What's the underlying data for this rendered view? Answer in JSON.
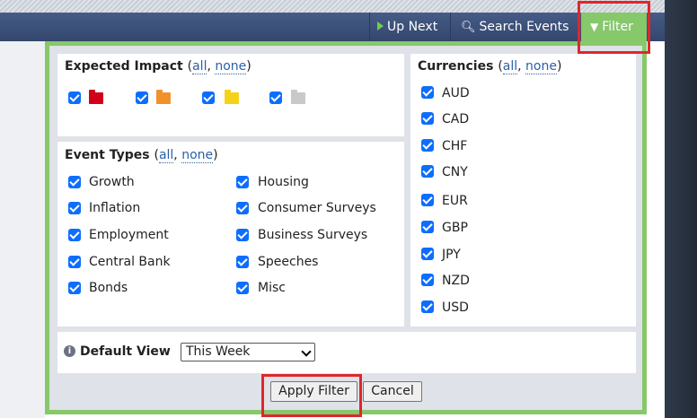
{
  "nav": {
    "up_next": "Up Next",
    "search_events": "Search Events",
    "filter": "Filter"
  },
  "impact": {
    "title": "Expected Impact",
    "all": "all",
    "none": "none",
    "levels": [
      {
        "name": "high",
        "color": "#d0021b"
      },
      {
        "name": "medium",
        "color": "#f0922b"
      },
      {
        "name": "low",
        "color": "#f5d21a"
      },
      {
        "name": "non-economic",
        "color": "#c9c9c9"
      }
    ]
  },
  "events": {
    "title": "Event Types",
    "all": "all",
    "none": "none",
    "col1": [
      "Growth",
      "Inflation",
      "Employment",
      "Central Bank",
      "Bonds"
    ],
    "col2": [
      "Housing",
      "Consumer Surveys",
      "Business Surveys",
      "Speeches",
      "Misc"
    ]
  },
  "currencies": {
    "title": "Currencies",
    "all": "all",
    "none": "none",
    "items": [
      "AUD",
      "CAD",
      "CHF",
      "CNY",
      "EUR",
      "GBP",
      "JPY",
      "NZD",
      "USD"
    ]
  },
  "default_view": {
    "label": "Default View",
    "selected": "This Week"
  },
  "actions": {
    "apply": "Apply Filter",
    "cancel": "Cancel"
  },
  "colors": {
    "accent_green": "#86c86a",
    "checkbox_blue": "#0d6efd",
    "highlight_red": "#e0262b"
  }
}
